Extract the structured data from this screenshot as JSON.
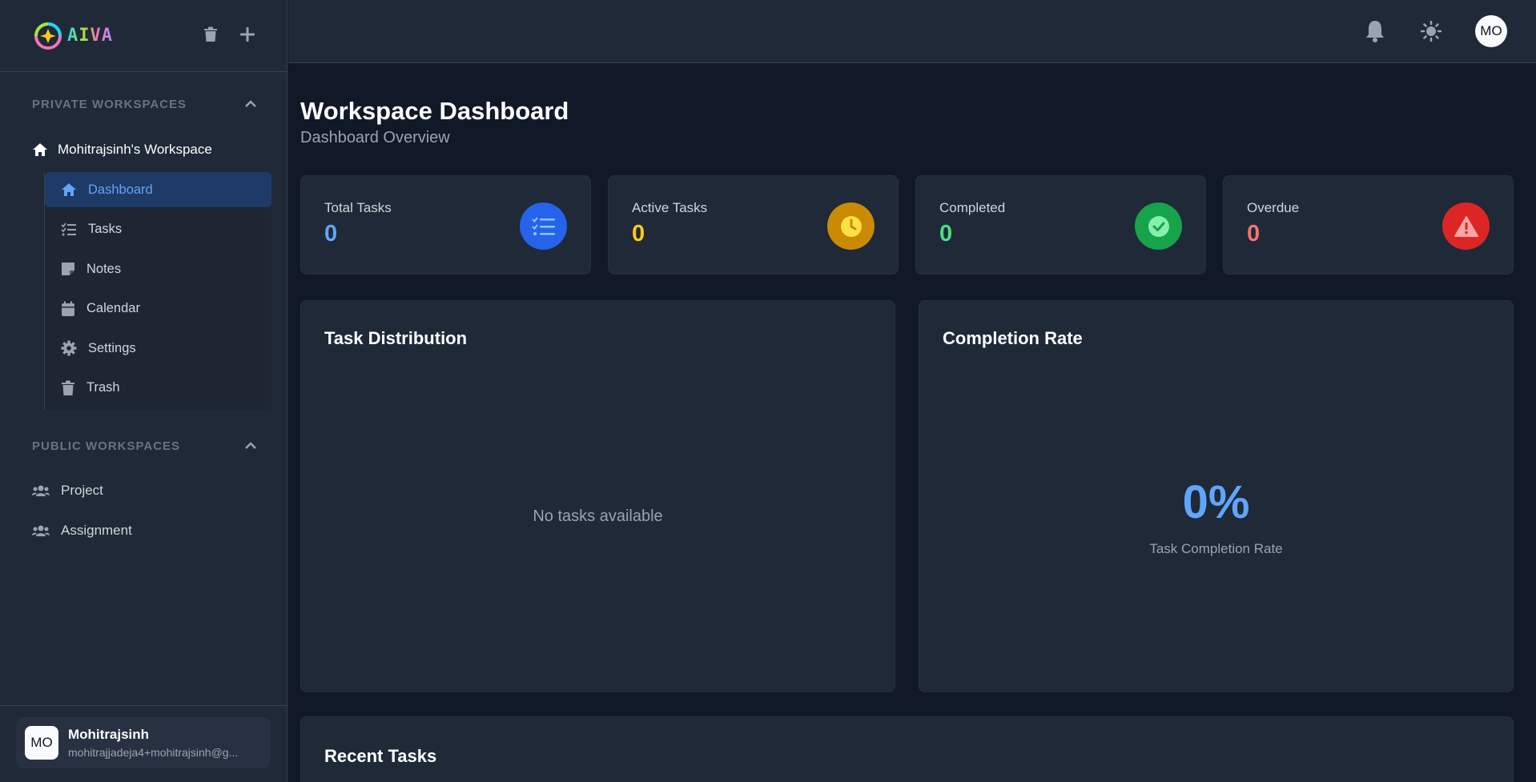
{
  "app": {
    "logo_text": "AIVA"
  },
  "sidebar": {
    "private_section_title": "PRIVATE WORKSPACES",
    "workspace_name": "Mohitrajsinh's Workspace",
    "nav": [
      {
        "label": "Dashboard",
        "icon": "home-icon",
        "active": true
      },
      {
        "label": "Tasks",
        "icon": "task-list-icon"
      },
      {
        "label": "Notes",
        "icon": "note-icon"
      },
      {
        "label": "Calendar",
        "icon": "calendar-icon"
      },
      {
        "label": "Settings",
        "icon": "gear-icon"
      },
      {
        "label": "Trash",
        "icon": "trash-icon"
      }
    ],
    "public_section_title": "PUBLIC WORKSPACES",
    "public_items": [
      {
        "label": "Project",
        "icon": "users-icon"
      },
      {
        "label": "Assignment",
        "icon": "users-icon"
      }
    ],
    "user": {
      "initials": "MO",
      "name": "Mohitrajsinh",
      "email": "mohitrajjadeja4+mohitrajsinh@g..."
    }
  },
  "topbar": {
    "avatar_initials": "MO"
  },
  "main": {
    "title": "Workspace Dashboard",
    "subtitle": "Dashboard Overview",
    "stats": [
      {
        "label": "Total Tasks",
        "value": "0",
        "color": "#60a5fa",
        "icon_bg": "#2563eb"
      },
      {
        "label": "Active Tasks",
        "value": "0",
        "color": "#facc15",
        "icon_bg": "#ca8a04"
      },
      {
        "label": "Completed",
        "value": "0",
        "color": "#4ade80",
        "icon_bg": "#16a34a"
      },
      {
        "label": "Overdue",
        "value": "0",
        "color": "#f87171",
        "icon_bg": "#dc2626"
      }
    ],
    "distribution": {
      "title": "Task Distribution",
      "empty_text": "No tasks available"
    },
    "completion": {
      "title": "Completion Rate",
      "value": "0%",
      "label": "Task Completion Rate"
    },
    "recent": {
      "title": "Recent Tasks"
    }
  }
}
